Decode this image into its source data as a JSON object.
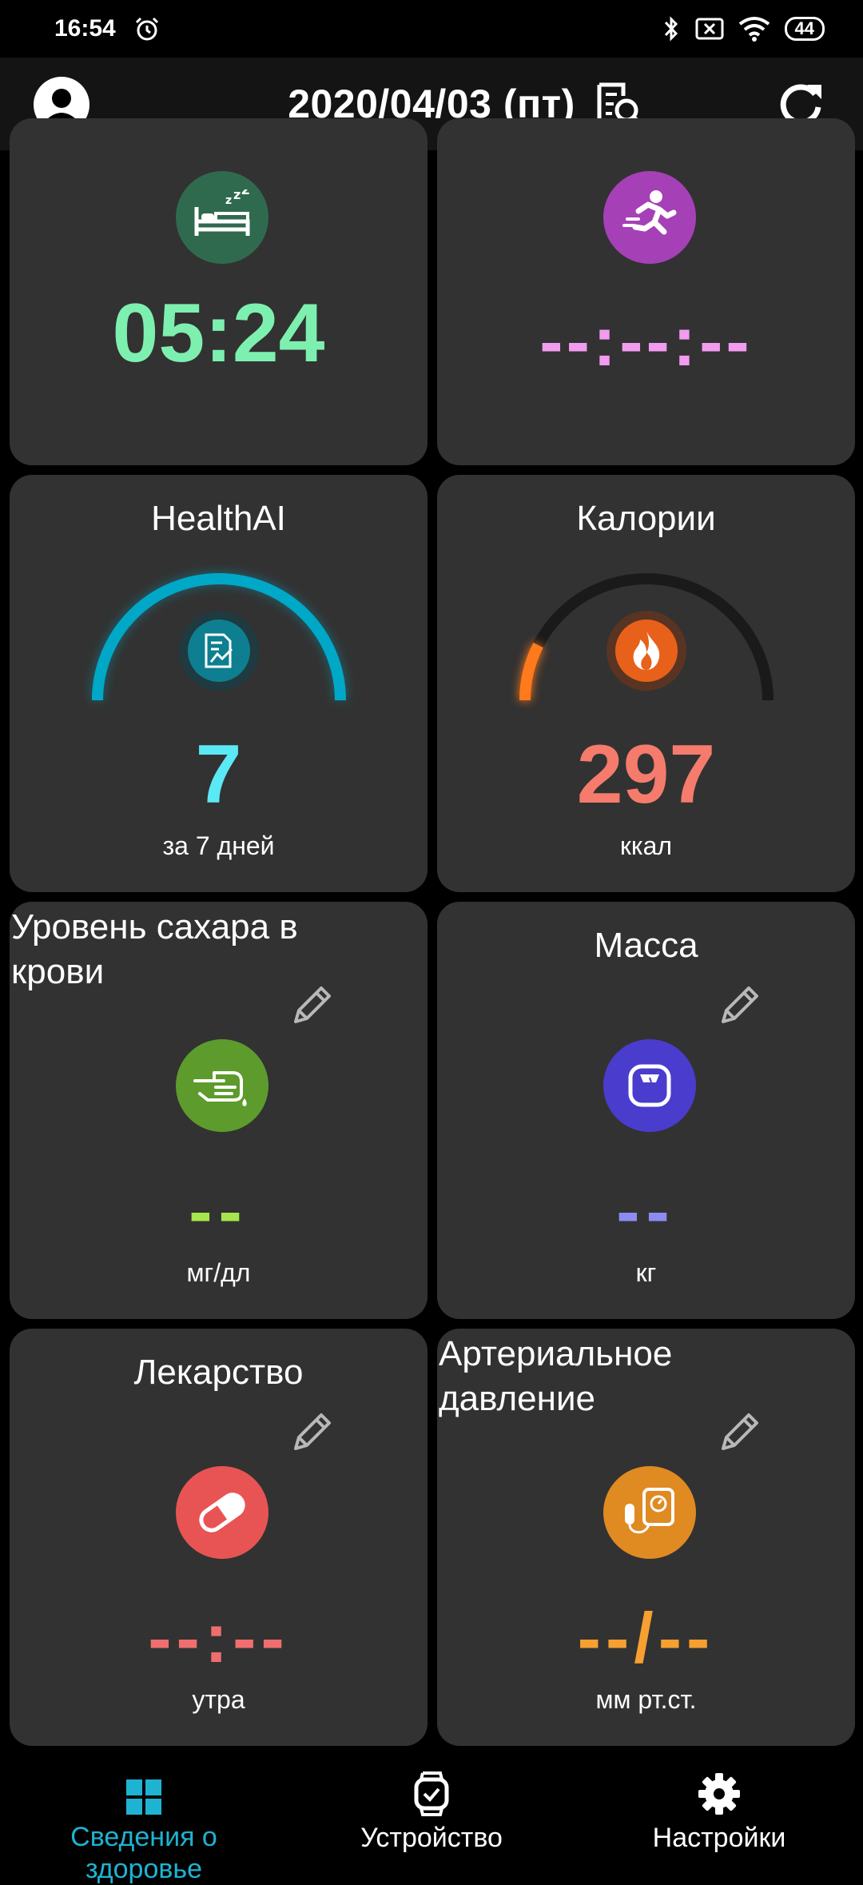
{
  "status_bar": {
    "time": "16:54",
    "battery": "44",
    "icons": [
      "alarm-icon",
      "bluetooth-icon",
      "sim-none-icon",
      "wifi-icon",
      "battery-icon"
    ]
  },
  "header": {
    "date": "2020/04/03 (пт)",
    "icons": [
      "avatar-icon",
      "search-document-icon",
      "refresh-icon"
    ]
  },
  "cards": {
    "sleep": {
      "value": "05:24",
      "color": "#7df0b0",
      "icon": "bed-icon",
      "icon_bg": "#2f6a4f"
    },
    "activity": {
      "value": "--:--:--",
      "color": "#f29cf0",
      "icon": "running-icon",
      "icon_bg": "#a640b6"
    },
    "healthai": {
      "title": "HealthAI",
      "value": "7",
      "unit": "за 7 дней",
      "color": "#5be9f5",
      "gauge_fraction": 1.0,
      "gauge_color": "#00a8c8",
      "icon": "report-chart-icon"
    },
    "calories": {
      "title": "Калории",
      "value": "297",
      "unit": "ккал",
      "color": "#f57b6c",
      "gauge_fraction": 0.15,
      "gauge_color": "#ff7a1a",
      "icon": "flame-icon"
    },
    "glucose": {
      "title": "Уровень сахара в крови",
      "value": "--",
      "unit": "мг/дл",
      "color": "#a6e64c",
      "icon": "finger-drop-icon",
      "icon_bg": "#5d9b2d"
    },
    "weight": {
      "title": "Масса",
      "value": "--",
      "unit": "кг",
      "color": "#8c8cf0",
      "icon": "scale-icon",
      "icon_bg": "#4a3ccd"
    },
    "medicine": {
      "title": "Лекарство",
      "value": "--:--",
      "unit": "утра",
      "color": "#f06e6e",
      "icon": "pill-icon",
      "icon_bg": "#e85454"
    },
    "pressure": {
      "title": "Артериальное давление",
      "value": "--/--",
      "unit": "мм рт.ст.",
      "color": "#f5a030",
      "icon": "blood-pressure-icon",
      "icon_bg": "#e08a22"
    }
  },
  "nav": {
    "items": [
      {
        "label": "Сведения о здоровье",
        "icon": "grid-icon",
        "active": true
      },
      {
        "label": "Устройство",
        "icon": "watch-icon",
        "active": false
      },
      {
        "label": "Настройки",
        "icon": "gear-icon",
        "active": false
      }
    ],
    "active_color": "#1eb3d2"
  }
}
